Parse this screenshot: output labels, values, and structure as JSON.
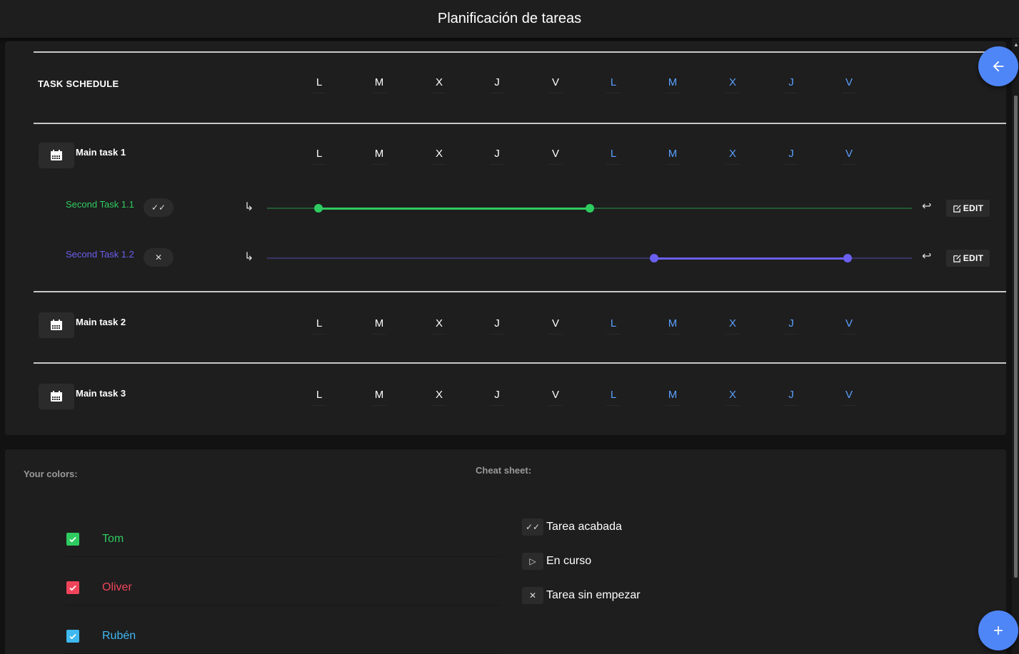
{
  "header": {
    "title": "Planificación de tareas"
  },
  "schedule": {
    "title": "TASK SCHEDULE",
    "week1_days": [
      "L",
      "M",
      "X",
      "J",
      "V"
    ],
    "week2_days": [
      "L",
      "M",
      "X",
      "J",
      "V"
    ],
    "main_tasks": [
      {
        "label": "Main task 1",
        "icon": "calendar-icon",
        "subtasks": [
          {
            "label": "Second Task 1.1",
            "status_icon": "double-check-icon",
            "status_glyph": "✓✓",
            "color": "#2ecc60",
            "range_start": 0.08,
            "range_end": 0.5,
            "edit_label": "EDIT"
          },
          {
            "label": "Second Task 1.2",
            "status_icon": "close-icon",
            "status_glyph": "✕",
            "color": "#6a5ff0",
            "range_start": 0.6,
            "range_end": 0.9,
            "edit_label": "EDIT"
          }
        ]
      },
      {
        "label": "Main task 2",
        "icon": "calendar-icon",
        "subtasks": []
      },
      {
        "label": "Main task 3",
        "icon": "calendar-icon",
        "subtasks": []
      }
    ]
  },
  "colors_section": {
    "title": "Your colors:",
    "people": [
      {
        "name": "Tom",
        "color": "#2ecc60",
        "checked": true
      },
      {
        "name": "Oliver",
        "color": "#f0445a",
        "checked": true
      },
      {
        "name": "Rubén",
        "color": "#3fb8f0",
        "checked": true
      }
    ]
  },
  "cheat_sheet": {
    "title": "Cheat sheet:",
    "items": [
      {
        "icon": "double-check-icon",
        "glyph": "✓✓",
        "label": "Tarea acabada"
      },
      {
        "icon": "play-icon",
        "glyph": "▷",
        "label": "En curso"
      },
      {
        "icon": "close-icon",
        "glyph": "✕",
        "label": "Tarea sin empezar"
      }
    ]
  },
  "fabs": {
    "back_icon": "arrow-left-icon",
    "add_icon": "plus-icon",
    "accent": "#4f86f7"
  }
}
